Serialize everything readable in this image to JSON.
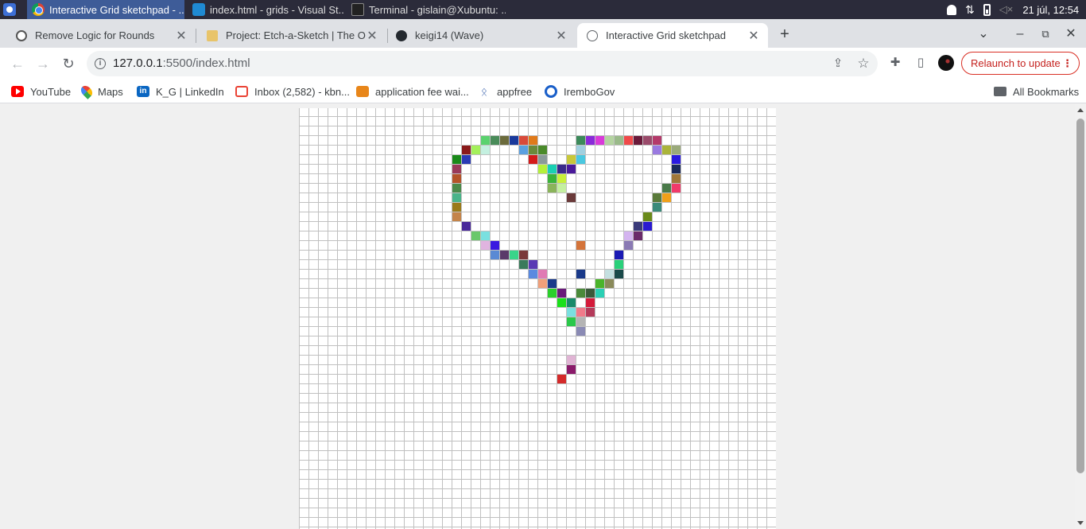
{
  "os": {
    "tasks": [
      {
        "title": "Interactive Grid sketchpad - ...",
        "icon": "chrome-icon"
      },
      {
        "title": "index.html - grids - Visual St...",
        "icon": "vscode-icon"
      },
      {
        "title": "Terminal - gislain@Xubuntu: ...",
        "icon": "terminal-icon"
      }
    ],
    "clock": "21 júl, 12:54"
  },
  "browser": {
    "tabs": [
      {
        "title": "Remove Logic for Rounds",
        "icon": "openai-icon"
      },
      {
        "title": "Project: Etch-a-Sketch | The Od",
        "icon": "odin-icon"
      },
      {
        "title": "keigi14 (Wave)",
        "icon": "github-icon"
      },
      {
        "title": "Interactive Grid sketchpad",
        "icon": "globe-icon",
        "active": true
      }
    ],
    "url_host": "127.0.0.1",
    "url_rest": ":5500/index.html",
    "relaunch_label": "Relaunch to update"
  },
  "bookmarks": [
    {
      "label": "YouTube",
      "icon": "youtube-icon"
    },
    {
      "label": "Maps",
      "icon": "maps-icon"
    },
    {
      "label": "K_G | LinkedIn",
      "icon": "linkedin-icon"
    },
    {
      "label": "Inbox (2,582) - kbn...",
      "icon": "gmail-icon"
    },
    {
      "label": "application fee wai...",
      "icon": "fee-icon"
    },
    {
      "label": "appfree",
      "icon": "appfree-icon"
    },
    {
      "label": "IremboGov",
      "icon": "irembo-icon"
    }
  ],
  "all_bookmarks_label": "All Bookmarks",
  "sketchpad": {
    "columns": 50,
    "grid_line_color": "#c0c0c0",
    "cell_fill": "#ffffff",
    "painted_cells": [
      [
        19,
        3,
        "#5ad26e"
      ],
      [
        20,
        3,
        "#4a8c5a"
      ],
      [
        21,
        3,
        "#6b6b3c"
      ],
      [
        22,
        3,
        "#1a3a9c"
      ],
      [
        23,
        3,
        "#d94a3a"
      ],
      [
        24,
        3,
        "#e07a1a"
      ],
      [
        29,
        3,
        "#3c8a5a"
      ],
      [
        30,
        3,
        "#8a2ad9"
      ],
      [
        31,
        3,
        "#d93ad9"
      ],
      [
        32,
        3,
        "#b4d4a0"
      ],
      [
        33,
        3,
        "#9aba8a"
      ],
      [
        34,
        3,
        "#f04a4a"
      ],
      [
        35,
        3,
        "#6a1a3a"
      ],
      [
        36,
        3,
        "#9a4a6a"
      ],
      [
        37,
        3,
        "#b43a6a"
      ],
      [
        17,
        4,
        "#8a1a1a"
      ],
      [
        18,
        4,
        "#a4f05a"
      ],
      [
        19,
        4,
        "#c4f0e0"
      ],
      [
        23,
        4,
        "#5aa0e0"
      ],
      [
        24,
        4,
        "#6a8a3a"
      ],
      [
        25,
        4,
        "#4a8a2a"
      ],
      [
        29,
        4,
        "#a0d0e0"
      ],
      [
        37,
        4,
        "#9a7ae0"
      ],
      [
        38,
        4,
        "#aab43a"
      ],
      [
        39,
        4,
        "#9aaa7a"
      ],
      [
        16,
        5,
        "#1a8a1a"
      ],
      [
        17,
        5,
        "#2a3ab4"
      ],
      [
        24,
        5,
        "#d41a1a"
      ],
      [
        25,
        5,
        "#8a9a9a"
      ],
      [
        28,
        5,
        "#c8c83a"
      ],
      [
        29,
        5,
        "#4ac8e0"
      ],
      [
        39,
        5,
        "#2a1ae0"
      ],
      [
        16,
        6,
        "#9a3a5a"
      ],
      [
        25,
        6,
        "#b4f03a"
      ],
      [
        26,
        6,
        "#1ad0b4"
      ],
      [
        27,
        6,
        "#3a2a8a"
      ],
      [
        28,
        6,
        "#4a1a9a"
      ],
      [
        39,
        6,
        "#1a2a5a"
      ],
      [
        16,
        7,
        "#b4542a"
      ],
      [
        26,
        7,
        "#3ab43a"
      ],
      [
        27,
        7,
        "#c8f03a"
      ],
      [
        39,
        7,
        "#a0783a"
      ],
      [
        16,
        8,
        "#4a8a4a"
      ],
      [
        26,
        8,
        "#8ab45a"
      ],
      [
        27,
        8,
        "#c4f0a0"
      ],
      [
        38,
        8,
        "#4a7a4a"
      ],
      [
        39,
        8,
        "#f03a6a"
      ],
      [
        16,
        9,
        "#4ab48a"
      ],
      [
        28,
        9,
        "#6a3a3a"
      ],
      [
        37,
        9,
        "#5a7a3a"
      ],
      [
        38,
        9,
        "#f0a01a"
      ],
      [
        16,
        10,
        "#9a7a1a"
      ],
      [
        37,
        10,
        "#3a8a7a"
      ],
      [
        16,
        11,
        "#c4844a"
      ],
      [
        36,
        11,
        "#6a8a1a"
      ],
      [
        17,
        12,
        "#4a2a9a"
      ],
      [
        35,
        12,
        "#3a3a7a"
      ],
      [
        36,
        12,
        "#2a1ad0"
      ],
      [
        18,
        13,
        "#6ac86a"
      ],
      [
        19,
        13,
        "#7ae0e0"
      ],
      [
        34,
        13,
        "#d4b4f0"
      ],
      [
        35,
        13,
        "#6a2a6a"
      ],
      [
        19,
        14,
        "#e0b4e0"
      ],
      [
        20,
        14,
        "#3a1ae0"
      ],
      [
        29,
        14,
        "#d4743a"
      ],
      [
        34,
        14,
        "#8a7ab4"
      ],
      [
        20,
        15,
        "#5a8ad4"
      ],
      [
        21,
        15,
        "#5a3a6a"
      ],
      [
        22,
        15,
        "#3ad48a"
      ],
      [
        23,
        15,
        "#7a3a3a"
      ],
      [
        33,
        15,
        "#1a1ab4"
      ],
      [
        23,
        16,
        "#3a7a5a"
      ],
      [
        24,
        16,
        "#5a3ab4"
      ],
      [
        33,
        16,
        "#2ad07a"
      ],
      [
        24,
        17,
        "#5a8ae0"
      ],
      [
        25,
        17,
        "#e07ab4"
      ],
      [
        29,
        17,
        "#1a3a8a"
      ],
      [
        32,
        17,
        "#c4e0e0"
      ],
      [
        33,
        17,
        "#1a4a4a"
      ],
      [
        25,
        18,
        "#f0a07a"
      ],
      [
        26,
        18,
        "#1a3a8a"
      ],
      [
        31,
        18,
        "#4ab42a"
      ],
      [
        32,
        18,
        "#8a8a5a"
      ],
      [
        26,
        19,
        "#2ad02a"
      ],
      [
        27,
        19,
        "#6a1a7a"
      ],
      [
        29,
        19,
        "#4a8a3a"
      ],
      [
        30,
        19,
        "#3a5a3a"
      ],
      [
        31,
        19,
        "#2ad0b4"
      ],
      [
        27,
        20,
        "#1ae01a"
      ],
      [
        28,
        20,
        "#1a8a6a"
      ],
      [
        30,
        20,
        "#d41a3a"
      ],
      [
        28,
        21,
        "#7ae0e0"
      ],
      [
        29,
        21,
        "#f07a8a"
      ],
      [
        30,
        21,
        "#b43a5a"
      ],
      [
        28,
        22,
        "#2ac84a"
      ],
      [
        29,
        22,
        "#b4b4b4"
      ],
      [
        29,
        23,
        "#8a8ab4"
      ],
      [
        28,
        26,
        "#e0b4d4"
      ],
      [
        28,
        27,
        "#8a1a6a"
      ],
      [
        27,
        28,
        "#d42a2a"
      ]
    ]
  }
}
